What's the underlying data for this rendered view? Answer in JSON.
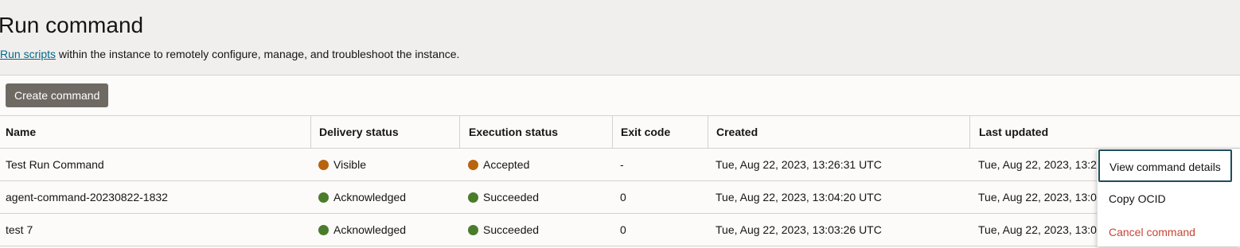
{
  "header": {
    "title": "Run command",
    "link_text": "Run scripts",
    "description": " within the instance to remotely configure, manage, and troubleshoot the instance."
  },
  "toolbar": {
    "create_label": "Create command"
  },
  "table": {
    "columns": [
      "Name",
      "Delivery status",
      "Execution status",
      "Exit code",
      "Created",
      "Last updated"
    ],
    "rows": [
      {
        "name": "Test Run Command",
        "delivery": "Visible",
        "delivery_color": "#b8640f",
        "execution": "Accepted",
        "execution_color": "#b8640f",
        "exit_code": "-",
        "created": "Tue, Aug 22, 2023, 13:26:31 UTC",
        "updated": "Tue, Aug 22, 2023, 13:2"
      },
      {
        "name": "agent-command-20230822-1832",
        "delivery": "Acknowledged",
        "delivery_color": "#4a7c2a",
        "execution": "Succeeded",
        "execution_color": "#4a7c2a",
        "exit_code": "0",
        "created": "Tue, Aug 22, 2023, 13:04:20 UTC",
        "updated": "Tue, Aug 22, 2023, 13:0"
      },
      {
        "name": "test 7",
        "delivery": "Acknowledged",
        "delivery_color": "#4a7c2a",
        "execution": "Succeeded",
        "execution_color": "#4a7c2a",
        "exit_code": "0",
        "created": "Tue, Aug 22, 2023, 13:03:26 UTC",
        "updated": "Tue, Aug 22, 2023, 13:0"
      }
    ]
  },
  "context_menu": {
    "items": [
      "View command details",
      "Copy OCID",
      "Cancel command"
    ]
  }
}
